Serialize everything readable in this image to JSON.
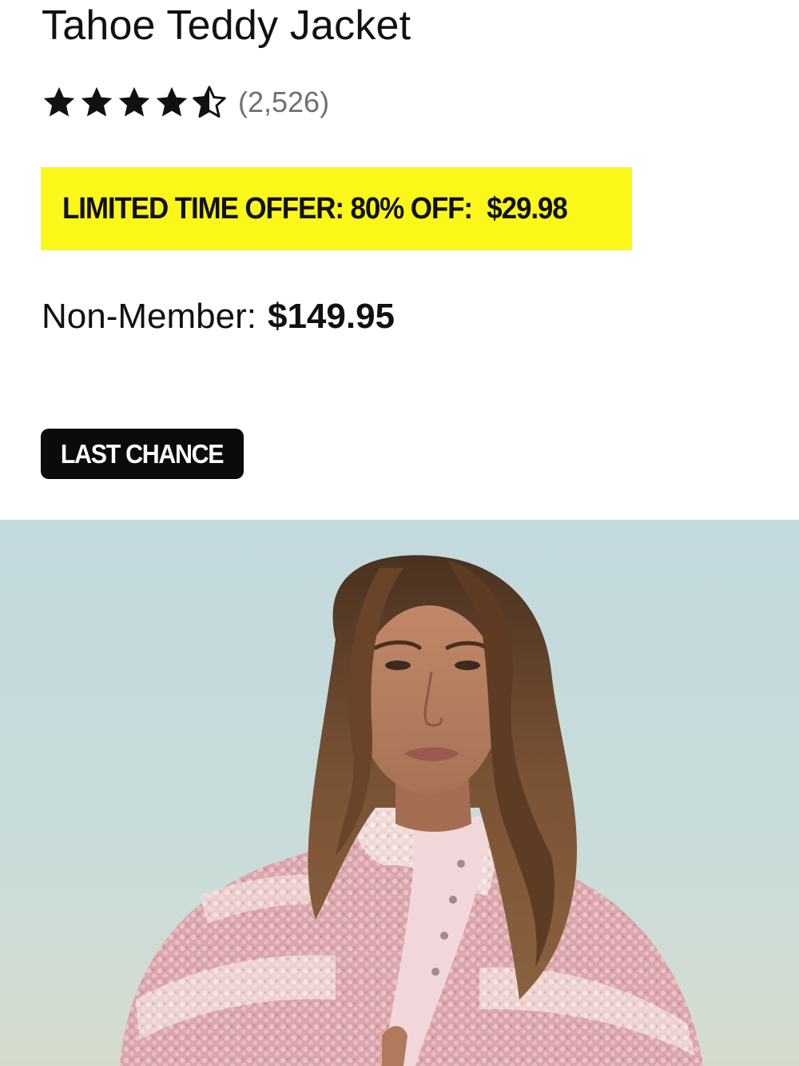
{
  "product": {
    "title": "Tahoe Teddy Jacket",
    "rating": {
      "value": 4.5,
      "max": 5,
      "count_label": "(2,526)"
    },
    "promo": {
      "label": "LIMITED TIME OFFER: 80% OFF:",
      "price": "$29.98",
      "background_color": "#fbf719"
    },
    "non_member": {
      "label": "Non-Member:",
      "price": "$149.95"
    },
    "badge": {
      "label": "LAST CHANCE"
    },
    "image": {
      "alt": "Tahoe Teddy Jacket"
    }
  }
}
